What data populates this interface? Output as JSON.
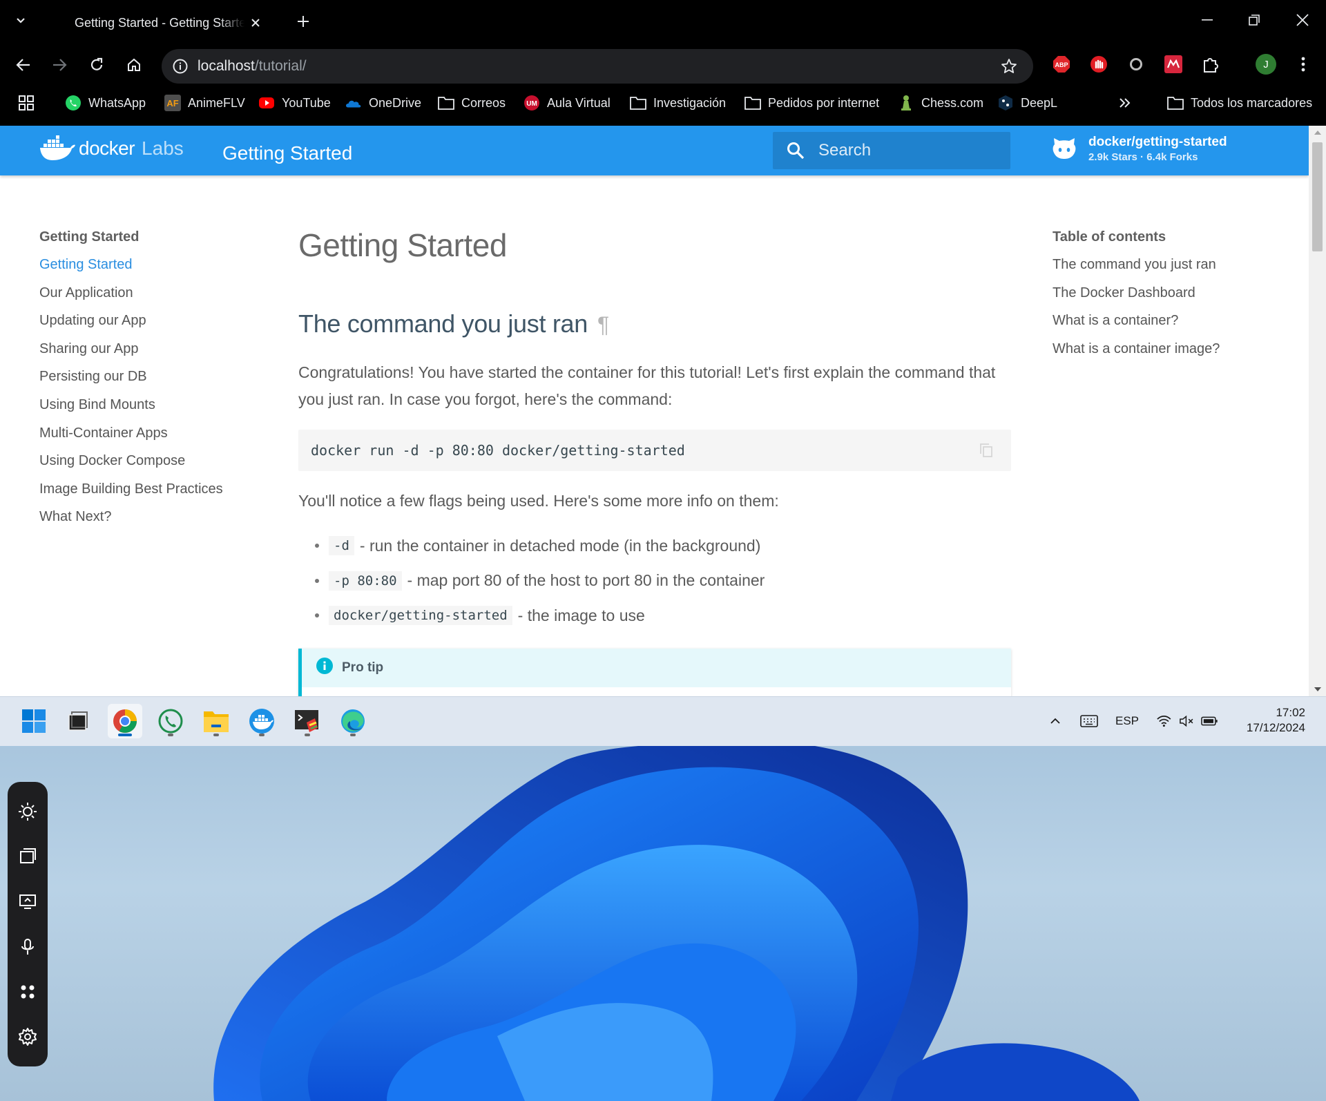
{
  "browser": {
    "tab_title": "Getting Started - Getting Started",
    "url_host": "localhost",
    "url_path": "/tutorial/",
    "profile_initial": "J",
    "bookmarks": [
      {
        "label": "WhatsApp",
        "icon": "whatsapp-icon"
      },
      {
        "label": "AnimeFLV",
        "icon": "animeflv-icon"
      },
      {
        "label": "YouTube",
        "icon": "youtube-icon"
      },
      {
        "label": "OneDrive",
        "icon": "onedrive-icon"
      },
      {
        "label": "Correos",
        "icon": "folder-icon"
      },
      {
        "label": "Aula Virtual",
        "icon": "um-icon"
      },
      {
        "label": "Investigación",
        "icon": "folder-icon"
      },
      {
        "label": "Pedidos por internet",
        "icon": "folder-icon"
      },
      {
        "label": "Chess.com",
        "icon": "chess-icon"
      },
      {
        "label": "DeepL",
        "icon": "deepl-icon"
      }
    ],
    "all_bookmarks": "Todos los marcadores"
  },
  "site": {
    "logo_word": "docker",
    "logo_labs": "Labs",
    "header_title": "Getting Started",
    "search_placeholder": "Search",
    "repo_name": "docker/getting-started",
    "repo_stats": "2.9k Stars · 6.4k Forks",
    "accent": "#2496ed"
  },
  "nav": {
    "heading": "Getting Started",
    "items": [
      "Getting Started",
      "Our Application",
      "Updating our App",
      "Sharing our App",
      "Persisting our DB",
      "Using Bind Mounts",
      "Multi-Container Apps",
      "Using Docker Compose",
      "Image Building Best Practices",
      "What Next?"
    ]
  },
  "toc": {
    "heading": "Table of contents",
    "items": [
      "The command you just ran",
      "The Docker Dashboard",
      "What is a container?",
      "What is a container image?"
    ]
  },
  "content": {
    "title": "Getting Started",
    "section_title": "The command you just ran",
    "anchor": "¶",
    "intro": "Congratulations! You have started the container for this tutorial! Let's first explain the command that you just ran. In case you forgot, here's the command:",
    "command": "docker run -d -p 80:80 docker/getting-started",
    "flags_intro": "You'll notice a few flags being used. Here's some more info on them:",
    "flags": [
      {
        "flag": "-d",
        "desc": "- run the container in detached mode (in the background)"
      },
      {
        "flag": "-p 80:80",
        "desc": "- map port 80 of the host to port 80 in the container"
      },
      {
        "flag": "docker/getting-started",
        "desc": "- the image to use"
      }
    ],
    "tip_title": "Pro tip"
  },
  "taskbar": {
    "apps": [
      "start-icon",
      "taskview-icon",
      "chrome-icon",
      "whatsapp-icon",
      "file-explorer-icon",
      "docker-icon",
      "terminal-icon",
      "edge-icon"
    ],
    "language": "ESP",
    "time": "17:02",
    "date": "17/12/2024"
  }
}
